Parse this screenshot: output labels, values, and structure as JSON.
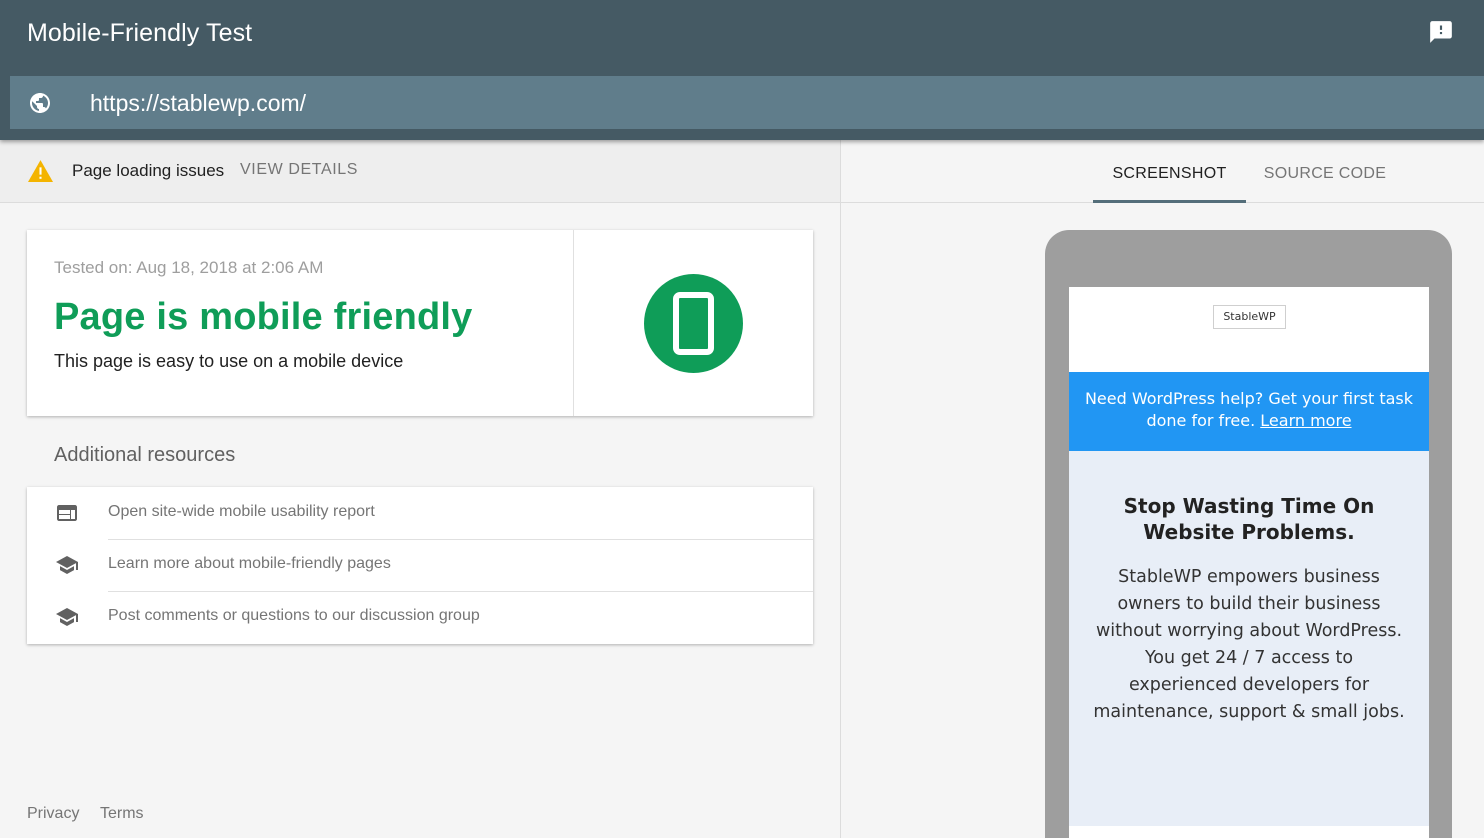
{
  "header": {
    "title": "Mobile-Friendly Test",
    "url_value": "https://stablewp.com/"
  },
  "issues": {
    "text": "Page loading issues",
    "action": "VIEW DETAILS"
  },
  "result": {
    "tested_on": "Tested on: Aug 18, 2018 at 2:06 AM",
    "verdict": "Page is mobile friendly",
    "subtext": "This page is easy to use on a mobile device"
  },
  "resources": {
    "heading": "Additional resources",
    "items": [
      {
        "label": "Open site-wide mobile usability report",
        "icon": "web-report-icon"
      },
      {
        "label": "Learn more about mobile-friendly pages",
        "icon": "school-icon"
      },
      {
        "label": "Post comments or questions to our discussion group",
        "icon": "school-icon"
      }
    ]
  },
  "footer": {
    "privacy": "Privacy",
    "terms": "Terms"
  },
  "tabs": [
    {
      "label": "SCREENSHOT",
      "active": true
    },
    {
      "label": "SOURCE CODE",
      "active": false
    }
  ],
  "preview": {
    "logo_text": "StableWP",
    "promo_text": "Need WordPress help? Get your first task done for free.",
    "promo_link": "Learn more",
    "hero_title": "Stop Wasting Time On Website Problems.",
    "hero_body_1": "StableWP empowers business owners to build their business without worrying about WordPress.",
    "hero_body_2": "You get 24 / 7 access to experienced developers for maintenance, support & small jobs."
  },
  "colors": {
    "header_bg": "#455a64",
    "url_bar_bg": "#607d8b",
    "success_green": "#0f9d58",
    "warning_yellow": "#f4b400",
    "promo_blue": "#2196f3"
  }
}
